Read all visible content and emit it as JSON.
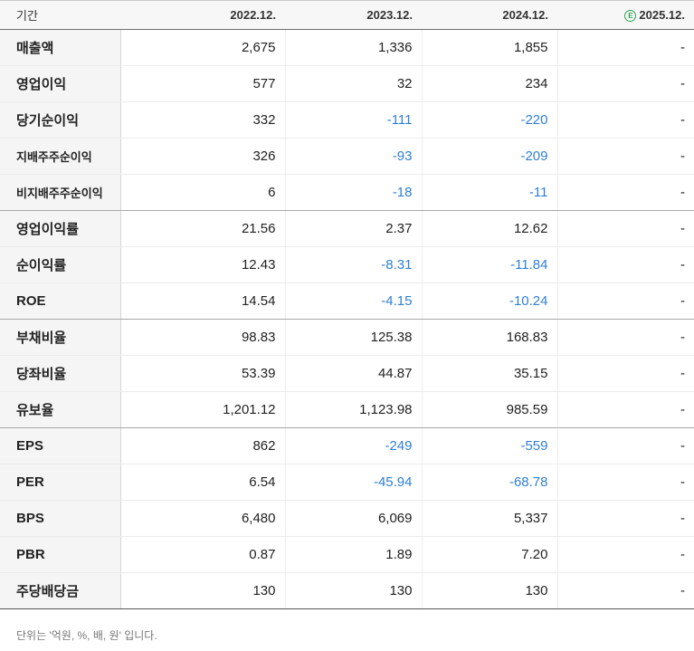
{
  "header": {
    "label": "기간",
    "periods": [
      "2022.12.",
      "2023.12.",
      "2024.12.",
      "2025.12."
    ],
    "estimate_badge_letter": "E"
  },
  "rows": [
    {
      "label": "매출액",
      "values": [
        "2,675",
        "1,336",
        "1,855",
        "-"
      ]
    },
    {
      "label": "영업이익",
      "values": [
        "577",
        "32",
        "234",
        "-"
      ]
    },
    {
      "label": "당기순이익",
      "values": [
        "332",
        "-111",
        "-220",
        "-"
      ]
    },
    {
      "label": "지배주주순이익",
      "values": [
        "326",
        "-93",
        "-209",
        "-"
      ]
    },
    {
      "label": "비지배주주순이익",
      "values": [
        "6",
        "-18",
        "-11",
        "-"
      ]
    },
    {
      "label": "영업이익률",
      "values": [
        "21.56",
        "2.37",
        "12.62",
        "-"
      ]
    },
    {
      "label": "순이익률",
      "values": [
        "12.43",
        "-8.31",
        "-11.84",
        "-"
      ]
    },
    {
      "label": "ROE",
      "values": [
        "14.54",
        "-4.15",
        "-10.24",
        "-"
      ]
    },
    {
      "label": "부채비율",
      "values": [
        "98.83",
        "125.38",
        "168.83",
        "-"
      ]
    },
    {
      "label": "당좌비율",
      "values": [
        "53.39",
        "44.87",
        "35.15",
        "-"
      ]
    },
    {
      "label": "유보율",
      "values": [
        "1,201.12",
        "1,123.98",
        "985.59",
        "-"
      ]
    },
    {
      "label": "EPS",
      "values": [
        "862",
        "-249",
        "-559",
        "-"
      ]
    },
    {
      "label": "PER",
      "values": [
        "6.54",
        "-45.94",
        "-68.78",
        "-"
      ]
    },
    {
      "label": "BPS",
      "values": [
        "6,480",
        "6,069",
        "5,337",
        "-"
      ]
    },
    {
      "label": "PBR",
      "values": [
        "0.87",
        "1.89",
        "7.20",
        "-"
      ]
    },
    {
      "label": "주당배당금",
      "values": [
        "130",
        "130",
        "130",
        "-"
      ]
    }
  ],
  "colors": {
    "negative": "#2f7fd4",
    "estimate_badge": "#2aa44f"
  },
  "footnote": "단위는 '억원, %, 배, 원' 입니다."
}
